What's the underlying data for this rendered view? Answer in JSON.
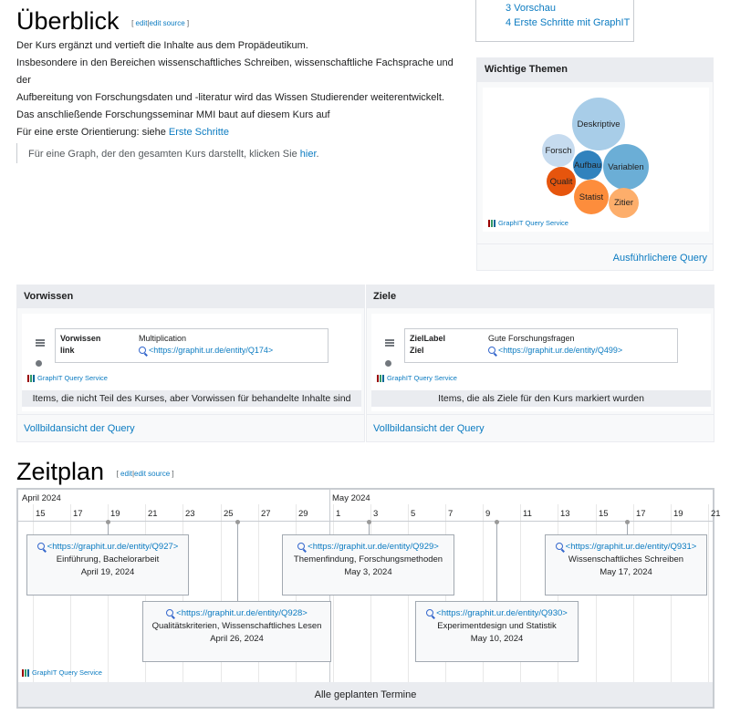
{
  "overview": {
    "title": "Überblick",
    "edit_links": [
      "edit",
      "edit source"
    ],
    "paragraphs": [
      "Der Kurs ergänzt und vertieft die Inhalte aus dem Propädeutikum.",
      "Insbesondere in den Bereichen wissenschaftliches Schreiben, wissenschaftliche Fachsprache und der",
      "Aufbereitung von Forschungsdaten und -literatur wird das Wissen Studierender weiterentwickelt.",
      "Das anschließende Forschungsseminar MMI baut auf diesem Kurs auf"
    ],
    "orientation_prefix": "Für eine erste Orientierung: siehe ",
    "orientation_link": "Erste Schritte",
    "graph_text": "Für eine Graph, der den gesamten Kurs darstellt, klicken Sie ",
    "graph_link": "hier",
    "graph_suffix": "."
  },
  "toc": {
    "items": [
      "3 Vorschau",
      "4 Erste Schritte mit GraphIT"
    ]
  },
  "themes": {
    "header": "Wichtige Themen",
    "bubbles": [
      {
        "label": "Deskriptive",
        "color": "#a8cde8"
      },
      {
        "label": "Forsch",
        "color": "#c6dbef"
      },
      {
        "label": "Variablen",
        "color": "#6baed6"
      },
      {
        "label": "Aufbau",
        "color": "#3182bd"
      },
      {
        "label": "Qualit",
        "color": "#e6550d"
      },
      {
        "label": "Statist",
        "color": "#fd8d3c"
      },
      {
        "label": "Zitier",
        "color": "#fdae6b"
      }
    ],
    "service_label": "GraphIT Query Service",
    "more_link": "Ausführlichere Query"
  },
  "prereq": {
    "header": "Vorwissen",
    "rows": [
      {
        "key": "Vorwissen",
        "value": "Multiplication"
      },
      {
        "key": "link",
        "value": "<https://graphit.ur.de/entity/Q174>"
      }
    ],
    "service_label": "GraphIT Query Service",
    "caption": "Items, die nicht Teil des Kurses, aber Vorwissen für behandelte Inhalte sind",
    "fullview_link": "Vollbildansicht der Query"
  },
  "goals": {
    "header": "Ziele",
    "rows": [
      {
        "key": "ZielLabel",
        "value": "Gute Forschungsfragen"
      },
      {
        "key": "Ziel",
        "value": "<https://graphit.ur.de/entity/Q499>"
      }
    ],
    "service_label": "GraphIT Query Service",
    "caption": "Items, die als Ziele für den Kurs markiert wurden",
    "fullview_link": "Vollbildansicht der Query"
  },
  "schedule": {
    "title": "Zeitplan",
    "edit_links": [
      "edit",
      "edit source"
    ],
    "months": [
      "April 2024",
      "May 2024"
    ],
    "days": [
      "15",
      "17",
      "19",
      "21",
      "23",
      "25",
      "27",
      "29",
      "1",
      "3",
      "5",
      "7",
      "9",
      "11",
      "13",
      "15",
      "17",
      "19",
      "21"
    ],
    "events": [
      {
        "link": "<https://graphit.ur.de/entity/Q927>",
        "title": "Einführung, Bachelorarbeit",
        "date": "April 19, 2024"
      },
      {
        "link": "<https://graphit.ur.de/entity/Q928>",
        "title": "Qualitätskriterien, Wissenschaftliches Lesen",
        "date": "April 26, 2024"
      },
      {
        "link": "<https://graphit.ur.de/entity/Q929>",
        "title": "Themenfindung, Forschungsmethoden",
        "date": "May 3, 2024"
      },
      {
        "link": "<https://graphit.ur.de/entity/Q930>",
        "title": "Experimentdesign und Statistik",
        "date": "May 10, 2024"
      },
      {
        "link": "<https://graphit.ur.de/entity/Q931>",
        "title": "Wissenschaftliches Schreiben",
        "date": "May 17, 2024"
      }
    ],
    "service_label": "GraphIT Query Service",
    "bottom_caption": "Alle geplanten Termine"
  }
}
